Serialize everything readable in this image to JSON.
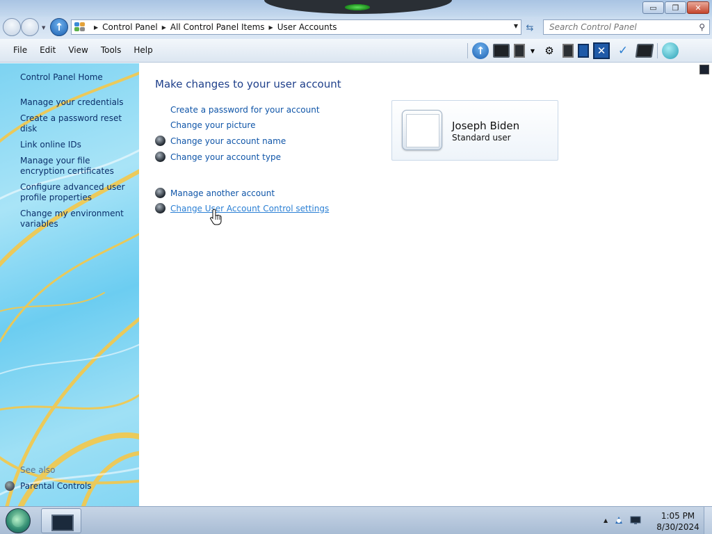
{
  "window": {
    "controls": {
      "minimize": "▭",
      "maximize": "❐",
      "close": "✕"
    }
  },
  "address": {
    "crumbs": [
      "Control Panel",
      "All Control Panel Items",
      "User Accounts"
    ],
    "search_placeholder": "Search Control Panel"
  },
  "menu": {
    "items": [
      "File",
      "Edit",
      "View",
      "Tools",
      "Help"
    ]
  },
  "toolbar": {
    "icons": [
      "up-arrow-icon",
      "monitor-icon",
      "document-icon",
      "camera-icon",
      "copy-icon",
      "page-icon",
      "close-box-icon",
      "check-icon",
      "monitor-dark-icon",
      "globe-icon"
    ]
  },
  "sidebar": {
    "home": "Control Panel Home",
    "links": [
      "Manage your credentials",
      "Create a password reset disk",
      "Link online IDs",
      "Manage your file encryption certificates",
      "Configure advanced user profile properties",
      "Change my environment variables"
    ],
    "see_also_title": "See also",
    "see_also_items": [
      "Parental Controls"
    ]
  },
  "main": {
    "heading": "Make changes to your user account",
    "tasks": [
      {
        "label": "Create a password for your account",
        "shield": false
      },
      {
        "label": "Change your picture",
        "shield": false
      },
      {
        "label": "Change your account name",
        "shield": true
      },
      {
        "label": "Change your account type",
        "shield": true
      },
      {
        "label": "Manage another account",
        "shield": true
      },
      {
        "label": "Change User Account Control settings",
        "shield": true
      }
    ]
  },
  "user": {
    "name": "Joseph Biden",
    "type": "Standard user"
  },
  "taskbar": {
    "time": "1:05 PM",
    "date": "8/30/2024"
  },
  "colors": {
    "link": "#0f55a8",
    "heading": "#1e3f8a",
    "sidebar_link": "#0b2f6a",
    "sidebar_bg": "#7dd3f2",
    "swirl": "#f5c84a"
  }
}
